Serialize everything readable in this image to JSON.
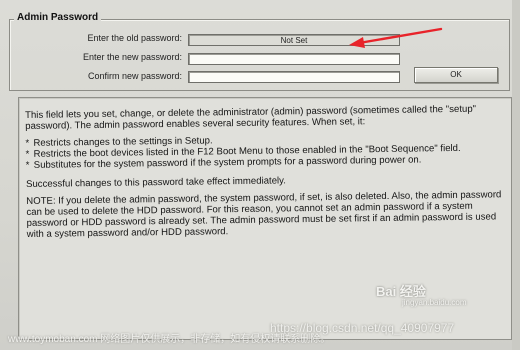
{
  "group": {
    "title": "Admin Password"
  },
  "fields": {
    "old_label": "Enter the old password:",
    "old_value": "Not Set",
    "new_label": "Enter the new password:",
    "confirm_label": "Confirm new password:"
  },
  "ok_label": "OK",
  "help": {
    "intro": "This field lets you set, change, or delete the administrator (admin) password (sometimes called the \"setup\" password). The admin password enables several security features. When set, it:",
    "bullet1": "Restricts changes to the settings in Setup.",
    "bullet2": "Restricts the boot devices listed in the F12 Boot Menu to those enabled in the \"Boot Sequence\" field.",
    "bullet3": "Substitutes for the system password if the system prompts for a password during power on.",
    "immediate": "Successful changes to this password take effect immediately.",
    "note": "NOTE: If you delete the admin password, the system password, if set, is also deleted. Also, the admin password can be used to delete the HDD password. For this reason, you cannot set an admin password if a system password or HDD password is already set. The admin password must be set first if an admin password is used with a system password and/or HDD password."
  },
  "watermarks": {
    "toymoban": "www.toymoban.com 网络图片仅供展示，非存储，如有侵权请联系删除。",
    "csdn": "https://blog.csdn.net/qq_40907977",
    "baidu": "Bai 经验",
    "baidu_sub": "jingyan.baidu.com"
  },
  "colors": {
    "arrow": "#e8232a"
  }
}
